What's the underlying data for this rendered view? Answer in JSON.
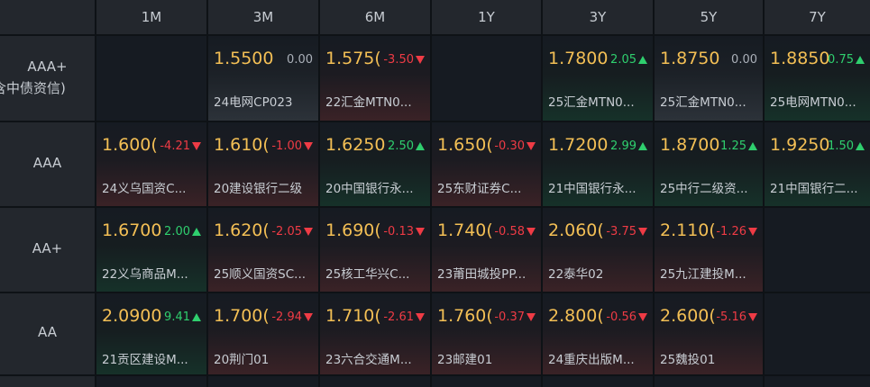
{
  "columns": [
    "1M",
    "3M",
    "6M",
    "1Y",
    "3Y",
    "5Y",
    "7Y"
  ],
  "rows": [
    {
      "label_lines": [
        "AAA+",
        "含中债资信)"
      ],
      "cells": [
        null,
        {
          "price": "1.5500",
          "change": "0.00",
          "dir": "flat",
          "name": "24电网CP023"
        },
        {
          "price": "1.575(",
          "change": "-3.50",
          "dir": "down",
          "name": "22汇金MTN0..."
        },
        null,
        {
          "price": "1.7800",
          "change": "2.05",
          "dir": "up",
          "name": "25汇金MTN0..."
        },
        {
          "price": "1.8750",
          "change": "0.00",
          "dir": "flat",
          "name": "25汇金MTN0..."
        },
        {
          "price": "1.8850",
          "change": "0.75",
          "dir": "up",
          "name": "25电网MTN0..."
        }
      ]
    },
    {
      "label_lines": [
        "AAA"
      ],
      "cells": [
        {
          "price": "1.600(",
          "change": "-4.21",
          "dir": "down",
          "name": "24义乌国资C..."
        },
        {
          "price": "1.610(",
          "change": "-1.00",
          "dir": "down",
          "name": "20建设银行二级"
        },
        {
          "price": "1.6250",
          "change": "2.50",
          "dir": "up",
          "name": "20中国银行永..."
        },
        {
          "price": "1.650(",
          "change": "-0.30",
          "dir": "down",
          "name": "25东财证券C..."
        },
        {
          "price": "1.7200",
          "change": "2.99",
          "dir": "up",
          "name": "21中国银行永..."
        },
        {
          "price": "1.8700",
          "change": "1.25",
          "dir": "up",
          "name": "25中行二级资..."
        },
        {
          "price": "1.9250",
          "change": "1.50",
          "dir": "up",
          "name": "21中国银行二..."
        }
      ]
    },
    {
      "label_lines": [
        "AA+"
      ],
      "cells": [
        {
          "price": "1.6700",
          "change": "2.00",
          "dir": "up",
          "name": "22义乌商品M..."
        },
        {
          "price": "1.620(",
          "change": "-2.05",
          "dir": "down",
          "name": "25顺义国资SC..."
        },
        {
          "price": "1.690(",
          "change": "-0.13",
          "dir": "down",
          "name": "25核工华兴C..."
        },
        {
          "price": "1.740(",
          "change": "-0.58",
          "dir": "down",
          "name": "23莆田城投PP..."
        },
        {
          "price": "2.060(",
          "change": "-3.75",
          "dir": "down",
          "name": "22泰华02"
        },
        {
          "price": "2.110(",
          "change": "-1.26",
          "dir": "down",
          "name": "25九江建投M..."
        },
        null
      ]
    },
    {
      "label_lines": [
        "AA"
      ],
      "cells": [
        {
          "price": "2.0900",
          "change": "9.41",
          "dir": "up",
          "name": "21贡区建设M..."
        },
        {
          "price": "1.700(",
          "change": "-2.94",
          "dir": "down",
          "name": "20荆门01"
        },
        {
          "price": "1.710(",
          "change": "-2.61",
          "dir": "down",
          "name": "23六合交通M..."
        },
        {
          "price": "1.760(",
          "change": "-0.37",
          "dir": "down",
          "name": "23邮建01"
        },
        {
          "price": "2.800(",
          "change": "-0.56",
          "dir": "down",
          "name": "24重庆出版M..."
        },
        {
          "price": "2.600(",
          "change": "-5.16",
          "dir": "down",
          "name": "25魏投01"
        },
        null
      ]
    }
  ]
}
